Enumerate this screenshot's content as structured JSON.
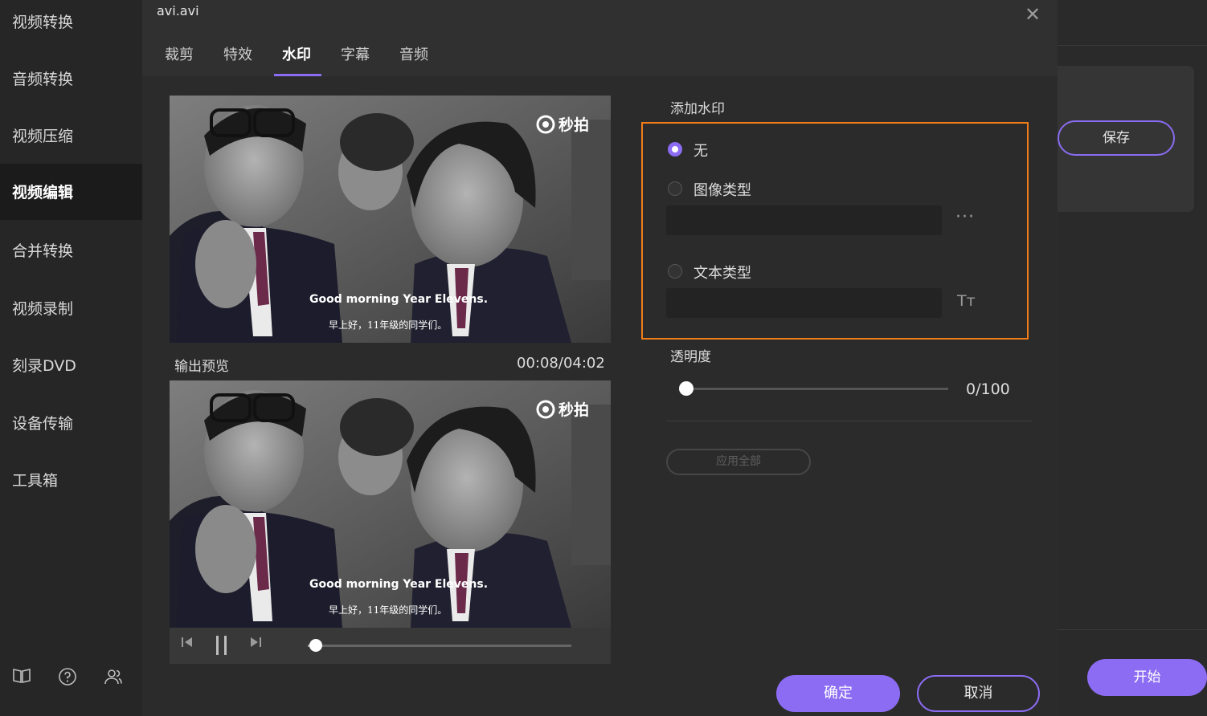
{
  "sidebar": {
    "items": [
      {
        "label": "视频转换"
      },
      {
        "label": "音频转换"
      },
      {
        "label": "视频压缩"
      },
      {
        "label": "视频编辑"
      },
      {
        "label": "合并转换"
      },
      {
        "label": "视频录制"
      },
      {
        "label": "刻录DVD"
      },
      {
        "label": "设备传输"
      },
      {
        "label": "工具箱"
      }
    ],
    "active_index": 3,
    "bottom_icons": [
      "book-icon",
      "help-icon",
      "users-icon"
    ]
  },
  "right_panel": {
    "save_label": "保存",
    "start_label": "开始"
  },
  "dialog": {
    "title": "avi.avi",
    "tabs": [
      {
        "label": "裁剪"
      },
      {
        "label": "特效"
      },
      {
        "label": "水印"
      },
      {
        "label": "字幕"
      },
      {
        "label": "音频"
      }
    ],
    "active_tab": 2,
    "video": {
      "subtitle_en": "Good morning Year Elevens.",
      "subtitle_cn": "早上好，11年级的同学们。",
      "logo_text": "秒拍"
    },
    "output_preview_label": "输出预览",
    "timecode": "00:08/04:02",
    "playback_progress": 0.03,
    "watermark": {
      "heading": "添加水印",
      "options": [
        {
          "label": "无",
          "selected": true
        },
        {
          "label": "图像类型",
          "selected": false
        },
        {
          "label": "文本类型",
          "selected": false
        }
      ],
      "image_field_value": "",
      "text_field_value": "",
      "browse_glyph": "···",
      "font_glyph": "Tт"
    },
    "opacity": {
      "label": "透明度",
      "value": 0,
      "max": 100,
      "display": "0/100"
    },
    "apply_all_label": "应用全部",
    "ok_label": "确定",
    "cancel_label": "取消"
  },
  "colors": {
    "accent": "#8c6cf3",
    "highlight_border": "#f07c1a",
    "background": "#2b2b2b"
  }
}
